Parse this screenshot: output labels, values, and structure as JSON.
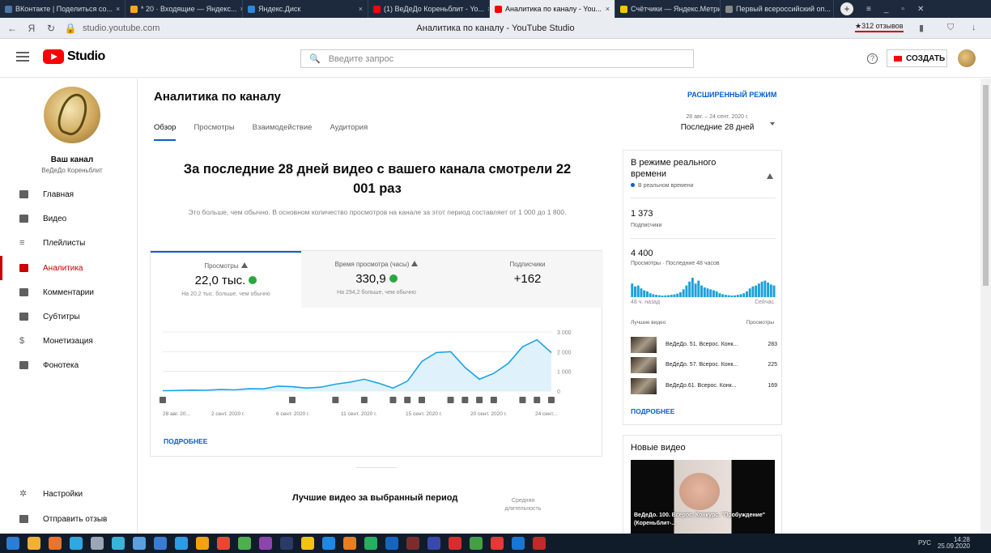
{
  "browser": {
    "tabs": [
      {
        "label": "ВКонтакте | Поделиться со...",
        "color": "#4a76a8"
      },
      {
        "label": "* 20 · Входящие — Яндекс...",
        "color": "#f5a623"
      },
      {
        "label": "Яндекс.Диск",
        "color": "#2f86d8"
      },
      {
        "label": "(1) ВеДеДо Кореньблит - Yo...",
        "color": "#ff0000"
      },
      {
        "label": "Аналитика по каналу - You...",
        "color": "#ff0000",
        "active": true
      },
      {
        "label": "Счётчики — Яндекс.Метрика",
        "color": "#f7c500"
      },
      {
        "label": "Первый всероссийский оп...",
        "color": "#888888"
      }
    ],
    "url": "studio.youtube.com",
    "page_title": "Аналитика по каналу - YouTube Studio",
    "reviews": "★312 отзывов"
  },
  "header": {
    "logo_text": "Studio",
    "search_placeholder": "Введите запрос",
    "create_label": "СОЗДАТЬ"
  },
  "sidebar": {
    "channel_title": "Ваш канал",
    "channel_name": "ВеДеДо Кореньблит",
    "items": [
      {
        "label": "Главная",
        "icon": "dashboard-icon"
      },
      {
        "label": "Видео",
        "icon": "video-icon"
      },
      {
        "label": "Плейлисты",
        "icon": "playlist-icon"
      },
      {
        "label": "Аналитика",
        "icon": "analytics-icon",
        "active": true
      },
      {
        "label": "Комментарии",
        "icon": "comments-icon"
      },
      {
        "label": "Субтитры",
        "icon": "subtitles-icon"
      },
      {
        "label": "Монетизация",
        "icon": "dollar-icon"
      },
      {
        "label": "Фонотека",
        "icon": "audio-library-icon"
      }
    ],
    "bottom": [
      {
        "label": "Настройки",
        "icon": "gear-icon"
      },
      {
        "label": "Отправить отзыв",
        "icon": "feedback-icon"
      }
    ]
  },
  "main": {
    "title": "Аналитика по каналу",
    "tabs": [
      "Обзор",
      "Просмотры",
      "Взаимодействие",
      "Аудитория"
    ],
    "advanced_mode": "РАСШИРЕННЫЙ РЕЖИМ",
    "date_range": "28 авг. – 24 сент. 2020 г.",
    "period": "Последние 28 дней",
    "headline": "За последние 28 дней видео с вашего канала смотрели 22 001 раз",
    "subline": "Это больше, чем обычно. В основном количество просмотров на канале за этот период составляет от 1 000 до 1 800.",
    "metrics": [
      {
        "label": "Просмотры",
        "value": "22,0 тыс.",
        "sub": "На 20,2 тыс. больше, чем обычно"
      },
      {
        "label": "Время просмотра (часы)",
        "value": "330,9",
        "sub": "На 294,2 больше, чем обычно"
      },
      {
        "label": "Подписчики",
        "value": "+162",
        "sub": ""
      }
    ],
    "more_label": "ПОДРОБНЕЕ",
    "best_videos_title": "Лучшие видео за выбранный период",
    "avg_duration_label": "Средняя длительность"
  },
  "chart_data": {
    "type": "area",
    "x_tick_labels": [
      "28 авг. 20...",
      "2 сент. 2020 г.",
      "6 сент. 2020 г.",
      "11 сент. 2020 г.",
      "15 сент. 2020 г.",
      "20 сент. 2020 г.",
      "24 сент..."
    ],
    "y_tick_labels": [
      "0",
      "1 000",
      "2 000",
      "3 000"
    ],
    "ylim": [
      0,
      3000
    ],
    "series": [
      {
        "values": [
          20,
          30,
          50,
          40,
          80,
          60,
          120,
          110,
          250,
          220,
          150,
          200,
          350,
          450,
          600,
          400,
          150,
          500,
          1500,
          1950,
          2000,
          1200,
          600,
          900,
          1400,
          2250,
          2600,
          1950
        ]
      }
    ],
    "color": "#1aa3e8"
  },
  "realtime": {
    "title": "В режиме реального времени",
    "live": "В реальном времени",
    "subscribers_value": "1 373",
    "subscribers_label": "Подписчики",
    "views_value": "4 400",
    "views_label": "Просмотры · Последние 48 часов",
    "axis_start": "48 ч. назад",
    "axis_end": "Сейчас",
    "top_videos_label": "Лучшие видео",
    "views_col": "Просмотры",
    "top_videos": [
      {
        "title": "ВеДеДо. 51. Всерос. Конк...",
        "views": "283"
      },
      {
        "title": "ВеДеДо. 57. Всерос. Конк...",
        "views": "225"
      },
      {
        "title": "ВеДеДо.61. Всерос. Конк...",
        "views": "169"
      }
    ],
    "bars": [
      70,
      55,
      60,
      45,
      35,
      30,
      20,
      15,
      12,
      10,
      8,
      9,
      10,
      12,
      14,
      18,
      25,
      40,
      60,
      80,
      100,
      70,
      85,
      60,
      50,
      45,
      40,
      35,
      30,
      20,
      15,
      12,
      10,
      8,
      9,
      12,
      15,
      20,
      30,
      45,
      55,
      60,
      70,
      80,
      85,
      75,
      65,
      60
    ],
    "more_label": "ПОДРОБНЕЕ"
  },
  "new_videos": {
    "title": "Новые видео",
    "caption": "ВеДеДо. 100. Всерос. Конкурс. \"Пробуждение\" (Кореньблит-..."
  },
  "taskbar": {
    "lang": "РУС",
    "time": "14:28",
    "date": "25.09.2020"
  }
}
